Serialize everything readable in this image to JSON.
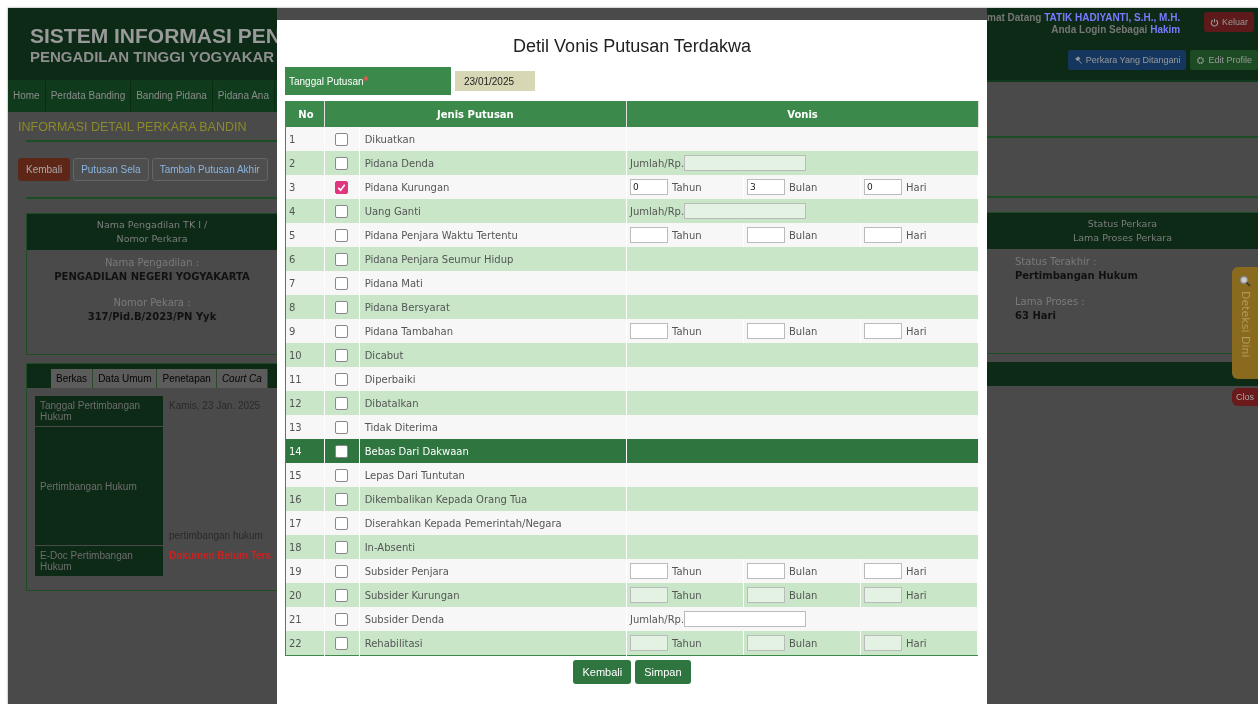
{
  "app_header": {
    "title": "SISTEM INFORMASI PEN",
    "subtitle": "PENGADILAN TINGGI YOGYAKAR",
    "greeting": "mat Datang",
    "user_name": "TATIK HADIYANTI, S.H., M.H.",
    "login_as": "Anda Login Sebagai",
    "role": "Hakim",
    "logout": "Keluar",
    "buttons": [
      {
        "label": "Perkara Yang Ditangani",
        "kind": "cases"
      },
      {
        "label": "Edit Profile",
        "kind": "profile"
      }
    ]
  },
  "nav": [
    "Home",
    "Perdata Banding",
    "Banding Pidana",
    "Pidana Ana"
  ],
  "page": {
    "heading": "INFORMASI DETAIL PERKARA BANDIN",
    "actions": [
      {
        "label": "Kembali",
        "kind": "danger"
      },
      {
        "label": "Putusan Sela",
        "kind": "outline"
      },
      {
        "label": "Tambah Putusan Akhir",
        "kind": "outline"
      }
    ],
    "court_box": {
      "header": [
        "Nama Pengadilan TK I /",
        "Nomor Perkara"
      ],
      "fields": [
        {
          "label": "Nama Pengadilan :",
          "value": "PENGADILAN NEGERI YOGYAKARTA"
        },
        {
          "label": "Nomor Pekara :",
          "value": "317/Pid.B/2023/PN Yyk"
        }
      ]
    },
    "status_box": {
      "header": [
        "Status Perkara",
        "Lama Proses Perkara"
      ],
      "fields": [
        {
          "label": "Status Terakhir :",
          "value": "Pertimbangan Hukum"
        },
        {
          "label": "Lama Proses :",
          "value": "63 Hari"
        }
      ]
    },
    "tabs": [
      {
        "label": "Berkas",
        "italic": false
      },
      {
        "label": "Data Umum",
        "italic": false
      },
      {
        "label": "Penetapan",
        "italic": false
      },
      {
        "label": "Court Ca",
        "italic": true
      }
    ],
    "details": [
      {
        "label": "Tanggal Pertimbangan Hukum",
        "value": "Kamis, 23 Jan. 2025",
        "kind": "top"
      },
      {
        "label": "Pertimbangan Hukum",
        "value": "pertimbangan hukum",
        "kind": "bottom"
      },
      {
        "label": "E-Doc Pertimbangan Hukum",
        "value": "Dokumen Belum Ters",
        "kind": "alert"
      }
    ],
    "side_tab": "Deteksi Dini",
    "close": "Clos"
  },
  "modal": {
    "title": "Detil Vonis Putusan Terdakwa",
    "date_label": "Tanggal Putusan",
    "required_mark": "*",
    "date_value": "23/01/2025",
    "columns": [
      "No",
      "Jenis Putusan",
      "Vonis"
    ],
    "rows": [
      {
        "no": "1",
        "checked": false,
        "highlighted": false,
        "name": "Dikuatkan",
        "vonis": {
          "kind": "none"
        }
      },
      {
        "no": "2",
        "checked": false,
        "highlighted": false,
        "name": "Pidana Denda",
        "vonis": {
          "kind": "amount",
          "label": "Jumlah/Rp."
        }
      },
      {
        "no": "3",
        "checked": true,
        "highlighted": false,
        "name": "Pidana Kurungan",
        "vonis": {
          "kind": "duration",
          "fields": [
            {
              "unit": "Tahun",
              "value": "0"
            },
            {
              "unit": "Bulan",
              "value": "3"
            },
            {
              "unit": "Hari",
              "value": "0"
            }
          ]
        }
      },
      {
        "no": "4",
        "checked": false,
        "highlighted": false,
        "name": "Uang Ganti",
        "vonis": {
          "kind": "amount",
          "label": "Jumlah/Rp."
        }
      },
      {
        "no": "5",
        "checked": false,
        "highlighted": false,
        "name": "Pidana Penjara Waktu Tertentu",
        "vonis": {
          "kind": "duration",
          "fields": [
            {
              "unit": "Tahun"
            },
            {
              "unit": "Bulan"
            },
            {
              "unit": "Hari"
            }
          ]
        }
      },
      {
        "no": "6",
        "checked": false,
        "highlighted": false,
        "name": "Pidana Penjara Seumur Hidup",
        "vonis": {
          "kind": "none"
        }
      },
      {
        "no": "7",
        "checked": false,
        "highlighted": false,
        "name": "Pidana Mati",
        "vonis": {
          "kind": "none"
        }
      },
      {
        "no": "8",
        "checked": false,
        "highlighted": false,
        "name": "Pidana Bersyarat",
        "vonis": {
          "kind": "none"
        }
      },
      {
        "no": "9",
        "checked": false,
        "highlighted": false,
        "name": "Pidana Tambahan",
        "vonis": {
          "kind": "duration",
          "fields": [
            {
              "unit": "Tahun"
            },
            {
              "unit": "Bulan"
            },
            {
              "unit": "Hari"
            }
          ]
        }
      },
      {
        "no": "10",
        "checked": false,
        "highlighted": false,
        "name": "Dicabut",
        "vonis": {
          "kind": "none"
        }
      },
      {
        "no": "11",
        "checked": false,
        "highlighted": false,
        "name": "Diperbaiki",
        "vonis": {
          "kind": "none"
        }
      },
      {
        "no": "12",
        "checked": false,
        "highlighted": false,
        "name": "Dibatalkan",
        "vonis": {
          "kind": "none"
        }
      },
      {
        "no": "13",
        "checked": false,
        "highlighted": false,
        "name": "Tidak Diterima",
        "vonis": {
          "kind": "none"
        }
      },
      {
        "no": "14",
        "checked": false,
        "highlighted": true,
        "name": "Bebas Dari Dakwaan",
        "vonis": {
          "kind": "none"
        }
      },
      {
        "no": "15",
        "checked": false,
        "highlighted": false,
        "name": "Lepas Dari Tuntutan",
        "vonis": {
          "kind": "none"
        }
      },
      {
        "no": "16",
        "checked": false,
        "highlighted": false,
        "name": "Dikembalikan Kepada Orang Tua",
        "vonis": {
          "kind": "none"
        }
      },
      {
        "no": "17",
        "checked": false,
        "highlighted": false,
        "name": "Diserahkan Kepada Pemerintah/Negara",
        "vonis": {
          "kind": "none"
        }
      },
      {
        "no": "18",
        "checked": false,
        "highlighted": false,
        "name": "In-Absenti",
        "vonis": {
          "kind": "none"
        }
      },
      {
        "no": "19",
        "checked": false,
        "highlighted": false,
        "name": "Subsider Penjara",
        "vonis": {
          "kind": "duration",
          "fields": [
            {
              "unit": "Tahun"
            },
            {
              "unit": "Bulan"
            },
            {
              "unit": "Hari"
            }
          ]
        }
      },
      {
        "no": "20",
        "checked": false,
        "highlighted": false,
        "name": "Subsider Kurungan",
        "vonis": {
          "kind": "duration",
          "fields": [
            {
              "unit": "Tahun"
            },
            {
              "unit": "Bulan"
            },
            {
              "unit": "Hari"
            }
          ]
        }
      },
      {
        "no": "21",
        "checked": false,
        "highlighted": false,
        "name": "Subsider Denda",
        "vonis": {
          "kind": "amount",
          "label": "Jumlah/Rp."
        }
      },
      {
        "no": "22",
        "checked": false,
        "highlighted": false,
        "name": "Rehabilitasi",
        "vonis": {
          "kind": "duration",
          "fields": [
            {
              "unit": "Tahun"
            },
            {
              "unit": "Bulan"
            },
            {
              "unit": "Hari"
            }
          ]
        }
      }
    ],
    "buttons": [
      "Kembali",
      "Simpan"
    ]
  }
}
